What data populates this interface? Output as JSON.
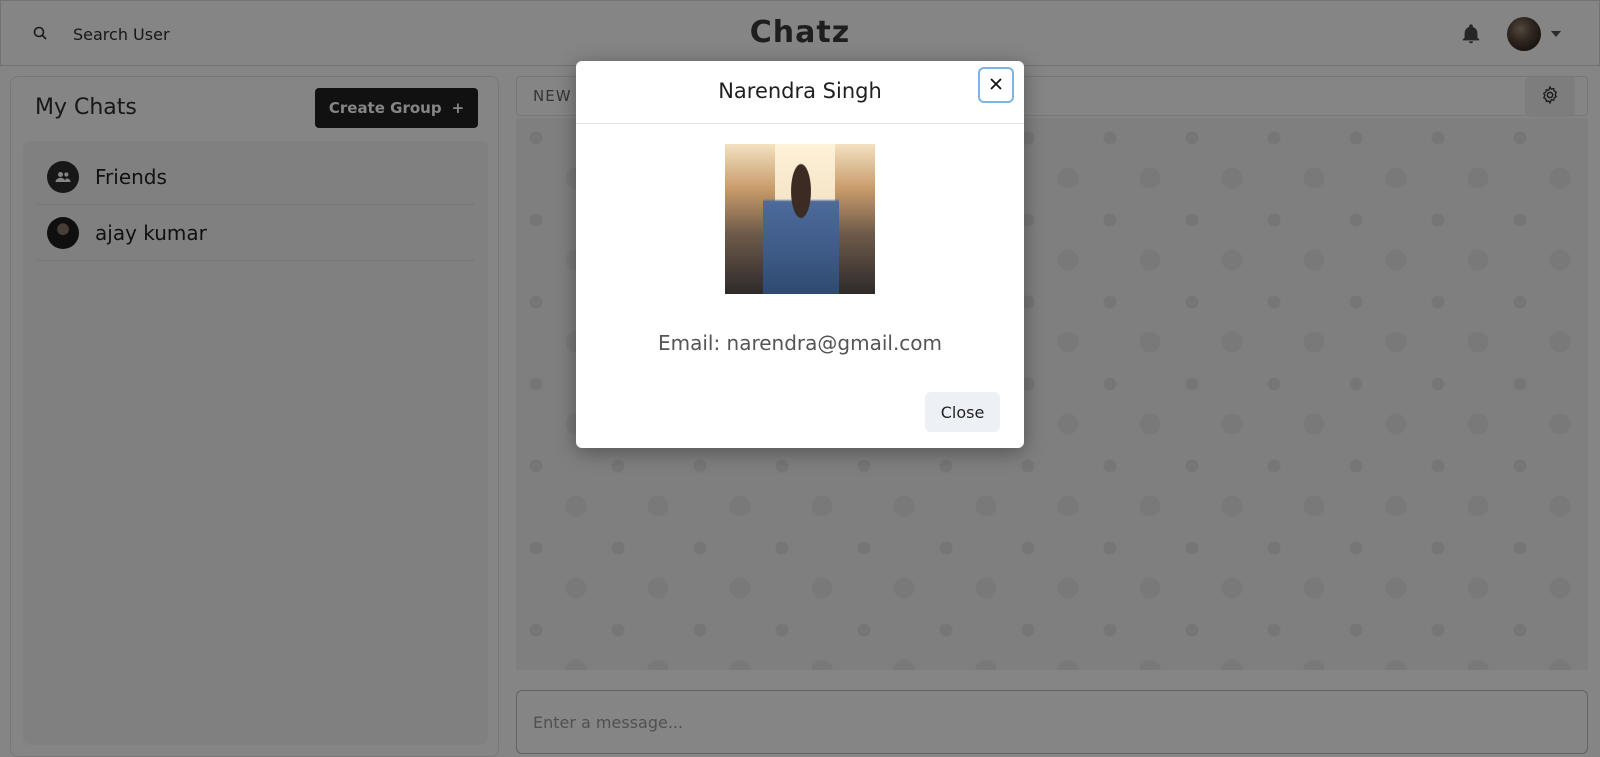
{
  "topbar": {
    "search_label": "Search User",
    "brand": "Chatz",
    "icons": {
      "search": "search-icon",
      "notifications": "bell-icon",
      "menu": "chevron-down-icon"
    }
  },
  "sidebar": {
    "title": "My Chats",
    "create_group_label": "Create Group",
    "create_group_icon": "+",
    "chats": [
      {
        "name": "Friends",
        "avatar": "group-icon"
      },
      {
        "name": "ajay kumar",
        "avatar": "user-avatar"
      }
    ]
  },
  "chat": {
    "header_title": "NEW",
    "message_placeholder": "Enter a message...",
    "settings_icon": "gear-icon"
  },
  "modal": {
    "title": "Narendra Singh",
    "email": "Email: narendra@gmail.com",
    "close_label": "Close",
    "close_icon": "close-icon"
  },
  "colors": {
    "primary_button": "#222222",
    "overlay": "rgba(0,0,0,0.48)",
    "close_button_bg": "#edf1f5",
    "focus_ring": "#7fb2e5"
  }
}
